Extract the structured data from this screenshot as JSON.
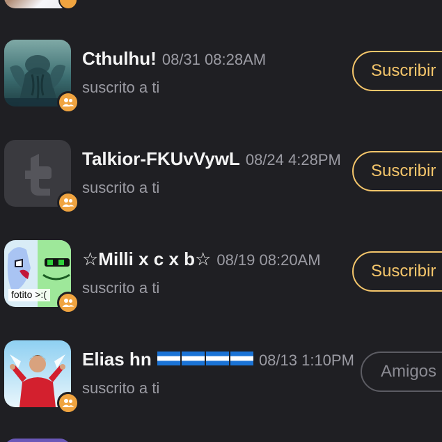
{
  "rows": [
    {
      "name": "Cthulhu!",
      "time": "08/31 08:28AM",
      "subtitle": "suscrito a ti",
      "button": "Suscribir"
    },
    {
      "name": "Talkior-FKUvVywL",
      "time": "08/24 4:28PM",
      "subtitle": "suscrito a ti",
      "button": "Suscribir"
    },
    {
      "name": "☆Milli x c x b☆",
      "time": "08/19 08:20AM",
      "subtitle": "suscrito a ti",
      "button": "Suscribir",
      "avatar_text": "fotito >:("
    },
    {
      "name": "Elias hn",
      "time": "08/13 1:10PM",
      "subtitle": "suscrito a ti",
      "button": "Amigos"
    }
  ],
  "icons": {
    "badge": "friends-icon",
    "flag": "honduras-flag-icon"
  },
  "colors": {
    "background": "#1f1f23",
    "accent": "#f5c66b",
    "badge": "#f0a440",
    "muted": "#9b9ba3"
  }
}
